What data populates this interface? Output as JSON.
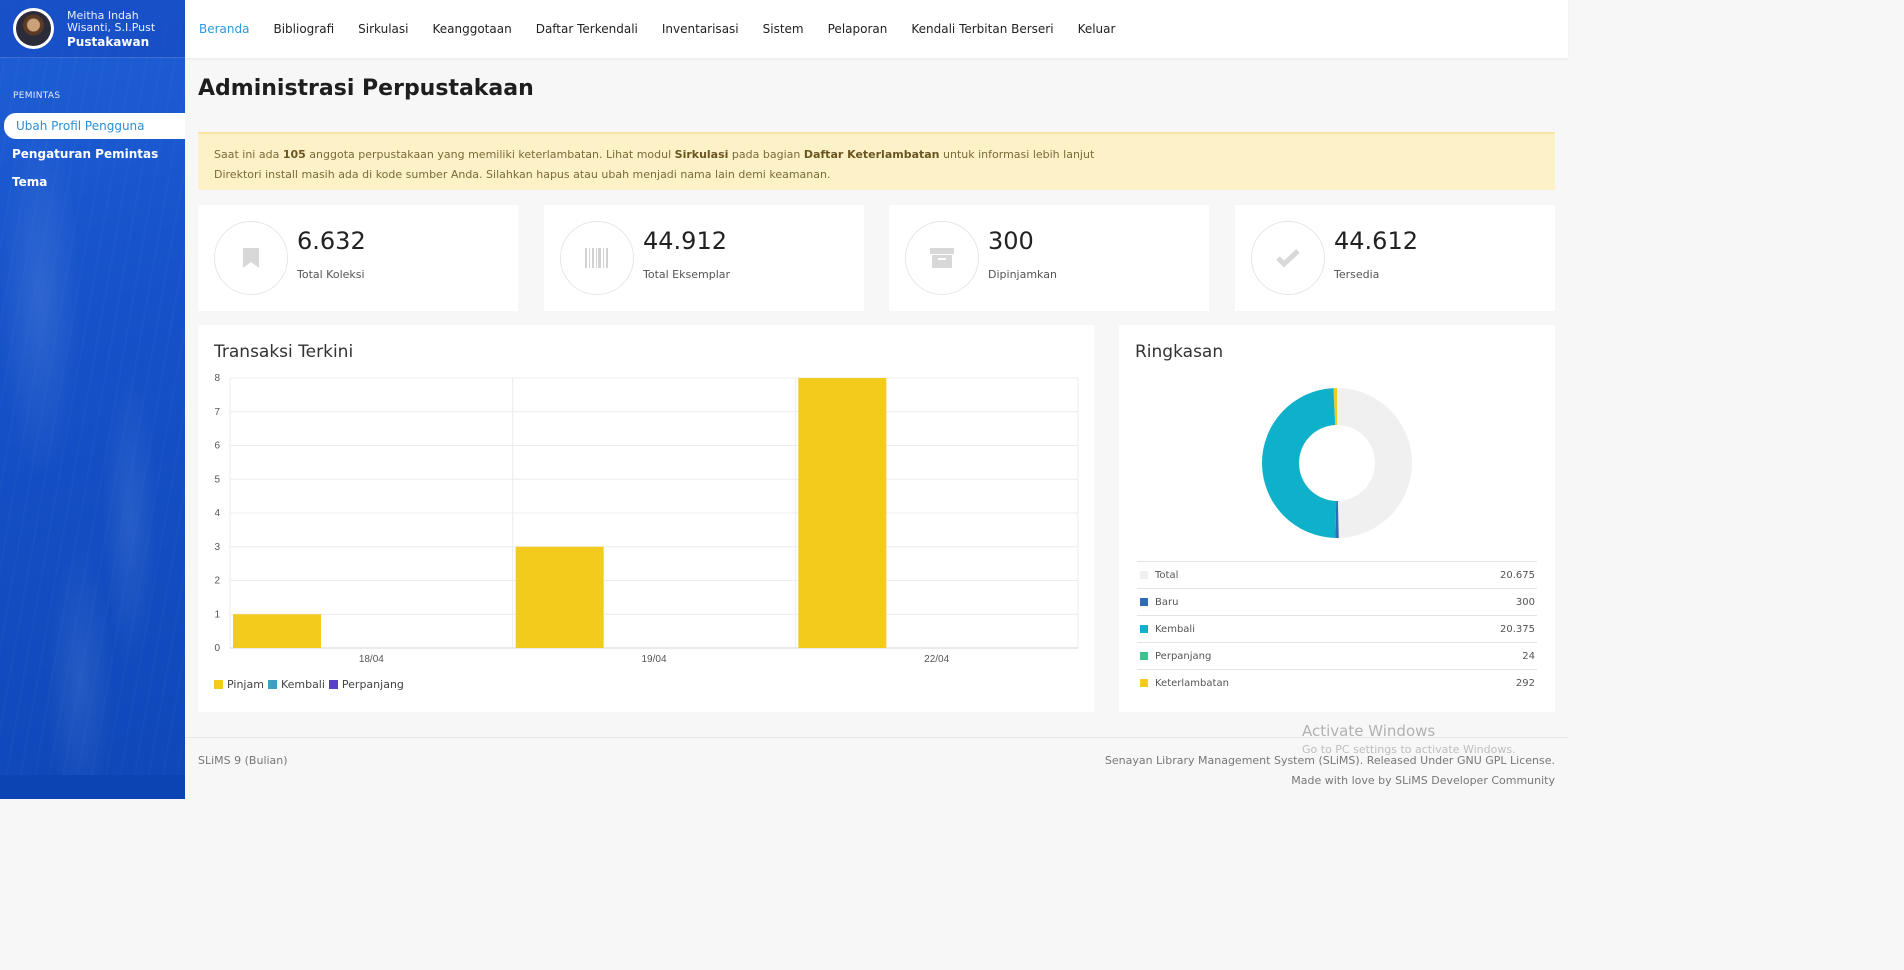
{
  "sidebar": {
    "user_name": "Meitha Indah Wisanti, S.I.Pust",
    "user_role": "Pustakawan",
    "section": "PEMINTAS",
    "items": [
      {
        "label": "Ubah Profil Pengguna"
      },
      {
        "label": "Pengaturan Pemintas"
      },
      {
        "label": "Tema"
      }
    ]
  },
  "nav": {
    "items": [
      {
        "label": "Beranda"
      },
      {
        "label": "Bibliografi"
      },
      {
        "label": "Sirkulasi"
      },
      {
        "label": "Keanggotaan"
      },
      {
        "label": "Daftar Terkendali"
      },
      {
        "label": "Inventarisasi"
      },
      {
        "label": "Sistem"
      },
      {
        "label": "Pelaporan"
      },
      {
        "label": "Kendali Terbitan Berseri"
      },
      {
        "label": "Keluar"
      }
    ],
    "active_index": 0
  },
  "page": {
    "title": "Administrasi Perpustakaan"
  },
  "alert": {
    "line1_pre": "Saat ini ada ",
    "line1_count": "105",
    "line1_mid1": " anggota perpustakaan yang memiliki keterlambatan. Lihat modul ",
    "line1_module": "Sirkulasi",
    "line1_mid2": " pada bagian ",
    "line1_section": "Daftar Keterlambatan",
    "line1_post": " untuk informasi lebih lanjut",
    "line2": "Direktori install masih ada di kode sumber Anda. Silahkan hapus atau ubah menjadi nama lain demi keamanan."
  },
  "stats": [
    {
      "value": "6.632",
      "label": "Total Koleksi",
      "icon": "bookmark-icon"
    },
    {
      "value": "44.912",
      "label": "Total Eksemplar",
      "icon": "barcode-icon"
    },
    {
      "value": "300",
      "label": "Dipinjamkan",
      "icon": "archive-icon"
    },
    {
      "value": "44.612",
      "label": "Tersedia",
      "icon": "check-icon"
    }
  ],
  "transactions": {
    "title": "Transaksi Terkini"
  },
  "chart_data": {
    "type": "bar",
    "title": "Transaksi Terkini",
    "categories": [
      "18/04",
      "19/04",
      "22/04"
    ],
    "series": [
      {
        "name": "Pinjam",
        "color": "#f2cb1d",
        "values": [
          1,
          3,
          8
        ]
      },
      {
        "name": "Kembali",
        "color": "#3d9fc2",
        "values": [
          0,
          0,
          0
        ]
      },
      {
        "name": "Perpanjang",
        "color": "#5a3fc4",
        "values": [
          0,
          0,
          0
        ]
      }
    ],
    "y_ticks": [
      "0",
      "1",
      "2",
      "3",
      "4",
      "5",
      "6",
      "7",
      "8"
    ],
    "ylim": [
      0,
      8
    ],
    "grid": true,
    "legend": "bottom-left"
  },
  "summary": {
    "title": "Ringkasan",
    "rows": [
      {
        "label": "Total",
        "value": "20.675",
        "amount": 20675,
        "color": "#f0f0f0"
      },
      {
        "label": "Baru",
        "value": "300",
        "amount": 300,
        "color": "#2f6db3"
      },
      {
        "label": "Kembali",
        "value": "20.375",
        "amount": 20375,
        "color": "#0fb0c9"
      },
      {
        "label": "Perpanjang",
        "value": "24",
        "amount": 24,
        "color": "#3cc28f"
      },
      {
        "label": "Keterlambatan",
        "value": "292",
        "amount": 292,
        "color": "#f2cb1d"
      }
    ]
  },
  "footer": {
    "version": "SLiMS 9 (Bulian)",
    "license": "Senayan Library Management System (SLiMS). Released Under GNU GPL License.",
    "credit": "Made with love by SLiMS Developer Community"
  },
  "watermark": {
    "title": "Activate Windows",
    "subtitle": "Go to PC settings to activate Windows."
  }
}
